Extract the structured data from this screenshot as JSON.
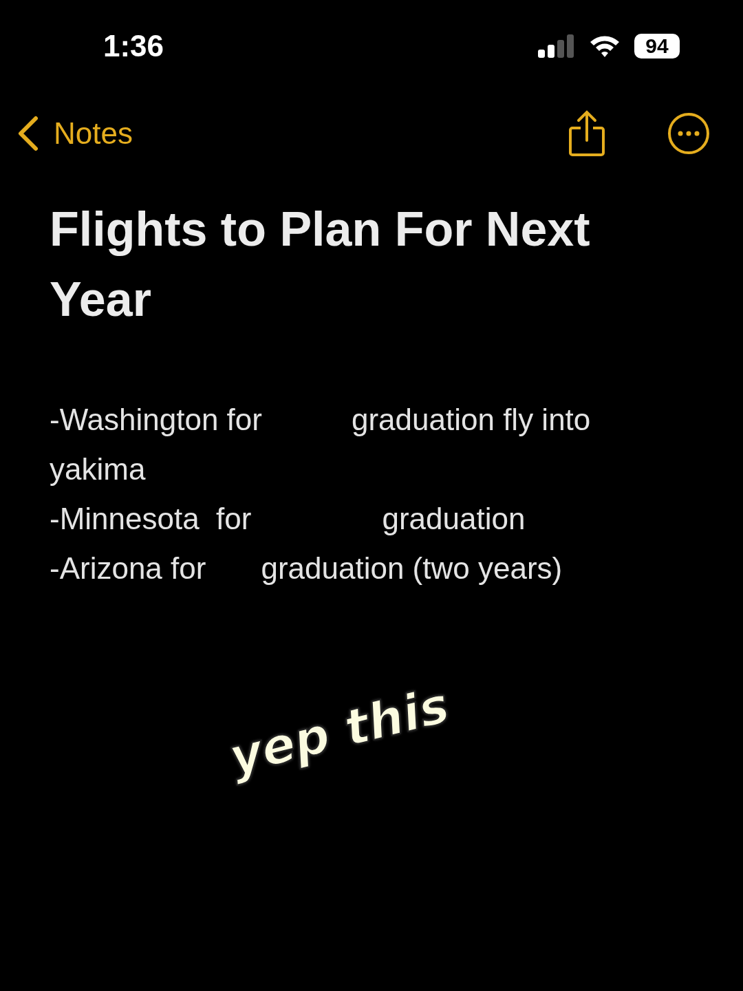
{
  "status_bar": {
    "time": "1:36",
    "battery": "94"
  },
  "nav": {
    "back_label": "Notes"
  },
  "note": {
    "title": "Flights to Plan For Next Year",
    "lines": [
      {
        "before": "-Washington for",
        "after": "graduation fly into",
        "continuation": "yakima"
      },
      {
        "before": "-Minnesota  for",
        "after": "graduation"
      },
      {
        "before": "-Arizona for",
        "after": "graduation (two years)"
      }
    ]
  },
  "sticker": {
    "text": "yep this"
  }
}
